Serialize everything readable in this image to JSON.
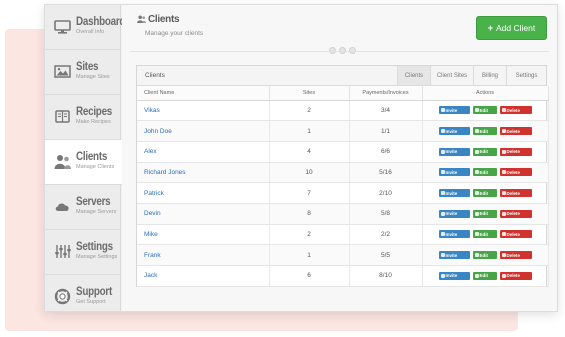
{
  "sidebar": {
    "items": [
      {
        "title": "Dashboard",
        "sub": "Overall Info",
        "icon": "monitor-icon",
        "active": false
      },
      {
        "title": "Sites",
        "sub": "Manage Sites",
        "icon": "image-icon",
        "active": false
      },
      {
        "title": "Recipes",
        "sub": "Make Recipes",
        "icon": "book-icon",
        "active": false
      },
      {
        "title": "Clients",
        "sub": "Manage Clients",
        "icon": "users-icon",
        "active": true
      },
      {
        "title": "Servers",
        "sub": "Manage Servers",
        "icon": "cloud-icon",
        "active": false
      },
      {
        "title": "Settings",
        "sub": "Manage Settings",
        "icon": "sliders-icon",
        "active": false
      },
      {
        "title": "Support",
        "sub": "Get Support",
        "icon": "lifebuoy-icon",
        "active": false
      }
    ]
  },
  "header": {
    "title": "Clients",
    "subtitle": "Manage your clients",
    "add_button": "Add Client",
    "add_button_color": "#4ab24a"
  },
  "panel": {
    "title": "Clients",
    "tabs": [
      "Clients",
      "Client Sites",
      "Billing",
      "Settings"
    ],
    "active_tab": "Clients"
  },
  "table": {
    "columns": [
      "Client Name",
      "Sites",
      "Payments/Invoices",
      "Actions"
    ],
    "actions": {
      "invite": "Invite",
      "edit": "Edit",
      "delete": "Delete"
    },
    "rows": [
      {
        "name": "Vikas",
        "sites": "2",
        "payments": "3/4"
      },
      {
        "name": "John Doe",
        "sites": "1",
        "payments": "1/1"
      },
      {
        "name": "Alex",
        "sites": "4",
        "payments": "6/6"
      },
      {
        "name": "Richard Jones",
        "sites": "10",
        "payments": "5/16"
      },
      {
        "name": "Patrick",
        "sites": "7",
        "payments": "2/10"
      },
      {
        "name": "Devin",
        "sites": "8",
        "payments": "5/8"
      },
      {
        "name": "Mike",
        "sites": "2",
        "payments": "2/2"
      },
      {
        "name": "Frank",
        "sites": "1",
        "payments": "5/5"
      },
      {
        "name": "Jack",
        "sites": "6",
        "payments": "8/10"
      }
    ]
  }
}
